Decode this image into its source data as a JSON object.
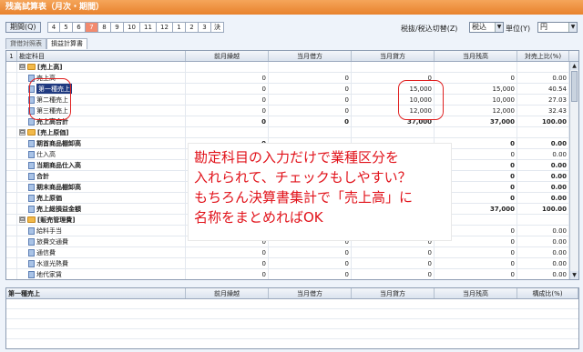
{
  "window": {
    "title": "残高試算表（月次・期間）"
  },
  "period": {
    "label": "期間(Q)",
    "months": [
      "4",
      "5",
      "6",
      "7",
      "8",
      "9",
      "10",
      "11",
      "12",
      "1",
      "2",
      "3",
      "決"
    ],
    "selected_index": 3
  },
  "tax": {
    "label": "税抜/税込切替(Z)",
    "value": "税込"
  },
  "unit": {
    "label": "単位(Y)",
    "value": "円"
  },
  "tabs": [
    "貸借対照表",
    "損益計算書"
  ],
  "grid": {
    "corner": "1",
    "headers": [
      "勘定科目",
      "前月繰越",
      "当月借方",
      "当月貸方",
      "当月残高",
      "対売上比(%)"
    ],
    "rows": [
      {
        "toggle": "⊟",
        "icon": "folder",
        "name": "[売上高]",
        "vals": [
          "",
          "",
          "",
          "",
          ""
        ],
        "style": "group"
      },
      {
        "toggle": "",
        "icon": "doc",
        "name": "売上高",
        "vals": [
          "0",
          "0",
          "0",
          "0",
          "0.00"
        ],
        "style": "item"
      },
      {
        "toggle": "",
        "icon": "doc",
        "name": "第一種売上",
        "vals": [
          "0",
          "0",
          "15,000",
          "15,000",
          "40.54"
        ],
        "style": "selected"
      },
      {
        "toggle": "",
        "icon": "doc",
        "name": "第二種売上",
        "vals": [
          "0",
          "0",
          "10,000",
          "10,000",
          "27.03"
        ],
        "style": "item"
      },
      {
        "toggle": "",
        "icon": "doc",
        "name": "第三種売上",
        "vals": [
          "0",
          "0",
          "12,000",
          "12,000",
          "32.43"
        ],
        "style": "item"
      },
      {
        "toggle": "",
        "icon": "doc",
        "name": "売上高合計",
        "vals": [
          "0",
          "0",
          "37,000",
          "37,000",
          "100.00"
        ],
        "style": "total"
      },
      {
        "toggle": "⊟",
        "icon": "folder",
        "name": "[売上原価]",
        "vals": [
          "",
          "",
          "",
          "",
          ""
        ],
        "style": "group"
      },
      {
        "toggle": "",
        "icon": "doc",
        "name": "期首商品棚卸高",
        "vals": [
          "0",
          "",
          "",
          "0",
          "0.00"
        ],
        "style": "total"
      },
      {
        "toggle": "",
        "icon": "doc",
        "name": "仕入高",
        "vals": [
          "",
          "",
          "",
          "0",
          "0.00"
        ],
        "style": "item"
      },
      {
        "toggle": "",
        "icon": "doc",
        "name": "当期商品仕入高",
        "vals": [
          "",
          "",
          "",
          "0",
          "0.00"
        ],
        "style": "total"
      },
      {
        "toggle": "",
        "icon": "doc",
        "name": "合計",
        "vals": [
          "",
          "",
          "",
          "0",
          "0.00"
        ],
        "style": "total"
      },
      {
        "toggle": "",
        "icon": "doc",
        "name": "期末商品棚卸高",
        "vals": [
          "",
          "",
          "",
          "0",
          "0.00"
        ],
        "style": "total"
      },
      {
        "toggle": "",
        "icon": "doc",
        "name": "売上原価",
        "vals": [
          "",
          "",
          "",
          "0",
          "0.00"
        ],
        "style": "total"
      },
      {
        "toggle": "",
        "icon": "doc",
        "name": "売上総損益金額",
        "vals": [
          "",
          "",
          "",
          "37,000",
          "100.00"
        ],
        "style": "total"
      },
      {
        "toggle": "⊟",
        "icon": "folder",
        "name": "[販売管理費]",
        "vals": [
          "",
          "",
          "",
          "",
          ""
        ],
        "style": "group"
      },
      {
        "toggle": "",
        "icon": "doc",
        "name": "給料手当",
        "vals": [
          "",
          "",
          "",
          "0",
          "0.00"
        ],
        "style": "item"
      },
      {
        "toggle": "",
        "icon": "doc",
        "name": "旅費交通費",
        "vals": [
          "0",
          "0",
          "0",
          "0",
          "0.00"
        ],
        "style": "item"
      },
      {
        "toggle": "",
        "icon": "doc",
        "name": "通信費",
        "vals": [
          "0",
          "0",
          "0",
          "0",
          "0.00"
        ],
        "style": "item"
      },
      {
        "toggle": "",
        "icon": "doc",
        "name": "水道光熱費",
        "vals": [
          "0",
          "0",
          "0",
          "0",
          "0.00"
        ],
        "style": "item"
      },
      {
        "toggle": "",
        "icon": "doc",
        "name": "地代家賃",
        "vals": [
          "0",
          "0",
          "0",
          "0",
          "0.00"
        ],
        "style": "item"
      }
    ]
  },
  "annotation": {
    "lines": [
      "勘定科目の入力だけで業種区分を",
      "入れられて、チェックもしやすい？",
      "もちろん決算書集計で「売上高」に",
      "名称をまとめればOK"
    ]
  },
  "detail": {
    "headers": [
      "第一種売上",
      "前月繰越",
      "当月借方",
      "当月貸方",
      "当月残高",
      "構成比(%)"
    ]
  }
}
